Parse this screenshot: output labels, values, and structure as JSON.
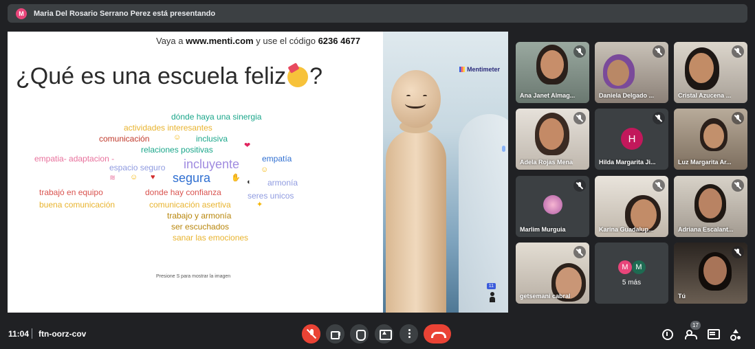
{
  "presenter_banner": {
    "avatar_letter": "M",
    "text": "Maria Del Rosario Serrano Perez está presentando"
  },
  "slide": {
    "code_prefix": "Vaya a ",
    "code_site": "www.menti.com",
    "code_middle": " y use el código ",
    "code_number": "6236 4677",
    "title_before": "¿Qué es una escuela feliz",
    "title_after": "?",
    "brand": "Mentimeter",
    "hint": "Presione S para mostrar la imagen",
    "responses_count": "11",
    "words": [
      {
        "text": "dónde haya una sinergia",
        "color": "#1aa68a"
      },
      {
        "text": "actividades interesantes",
        "color": "#e8b32e"
      },
      {
        "text": "comunicación",
        "color": "#c0392b"
      },
      {
        "text": "inclusiva",
        "color": "#1aa68a"
      },
      {
        "text": "relaciones positivas",
        "color": "#1aa68a"
      },
      {
        "text": "empatía",
        "color": "#2f6fd1"
      },
      {
        "text": "empatia- adaptacion -",
        "color": "#e8719c"
      },
      {
        "text": "incluyente",
        "color": "#a08be0"
      },
      {
        "text": "espacio seguro",
        "color": "#8f9be0"
      },
      {
        "text": "segura",
        "color": "#2f6fd1"
      },
      {
        "text": "armonía",
        "color": "#8f9be0"
      },
      {
        "text": "trabajó en equipo",
        "color": "#d9534f"
      },
      {
        "text": "donde hay confianza",
        "color": "#d9534f"
      },
      {
        "text": "seres unicos",
        "color": "#8f9be0"
      },
      {
        "text": "buena comunicación",
        "color": "#e8b32e"
      },
      {
        "text": "comunicación asertiva",
        "color": "#e8b32e"
      },
      {
        "text": "trabajo y armonía",
        "color": "#b8860b"
      },
      {
        "text": "ser escuchados",
        "color": "#b8860b"
      },
      {
        "text": "sanar las emociones",
        "color": "#e8b32e"
      }
    ],
    "glyphs": [
      {
        "char": "❤",
        "color": "#e0245e"
      },
      {
        "char": "☺",
        "color": "#f4b400"
      },
      {
        "char": "☺",
        "color": "#f4b400"
      },
      {
        "char": "♥",
        "color": "#d32f2f"
      },
      {
        "char": "☺",
        "color": "#f4b400"
      },
      {
        "char": "✦",
        "color": "#f4b400"
      },
      {
        "char": "◐",
        "color": "#333333"
      },
      {
        "char": "✋",
        "color": "#e0a070"
      },
      {
        "char": "≋",
        "color": "#e8719c"
      }
    ]
  },
  "participants": [
    {
      "name": "Ana Janet Almag...",
      "muted": true
    },
    {
      "name": "Daniela Delgado ...",
      "muted": true
    },
    {
      "name": "Cristal Azucena ...",
      "muted": true
    },
    {
      "name": "Adela Rojas Mena",
      "muted": true
    },
    {
      "name": "Hilda Margarita Ji...",
      "muted": true,
      "avatar_letter": "H",
      "avatar_color": "#c2185b"
    },
    {
      "name": "Luz Margarita Ar...",
      "muted": true
    },
    {
      "name": "Marlim Murguia",
      "muted": true
    },
    {
      "name": "Karina Guadalup...",
      "muted": true
    },
    {
      "name": "Adriana Escalant...",
      "muted": true
    },
    {
      "name": "getsemani cabral",
      "muted": true
    },
    {
      "name": "Tú",
      "muted": true
    }
  ],
  "more_tile": {
    "label": "5 más",
    "avatars": [
      {
        "letter": "M",
        "color": "#e8457a"
      },
      {
        "letter": "M",
        "color": "#1e6b52"
      }
    ]
  },
  "bottom_bar": {
    "time": "11:04",
    "meeting_code": "ftn-oorz-cov",
    "participant_count": "17",
    "colors": {
      "hangup": "#ea4335",
      "mic_off": "#ea4335",
      "button": "#3c4043"
    }
  }
}
